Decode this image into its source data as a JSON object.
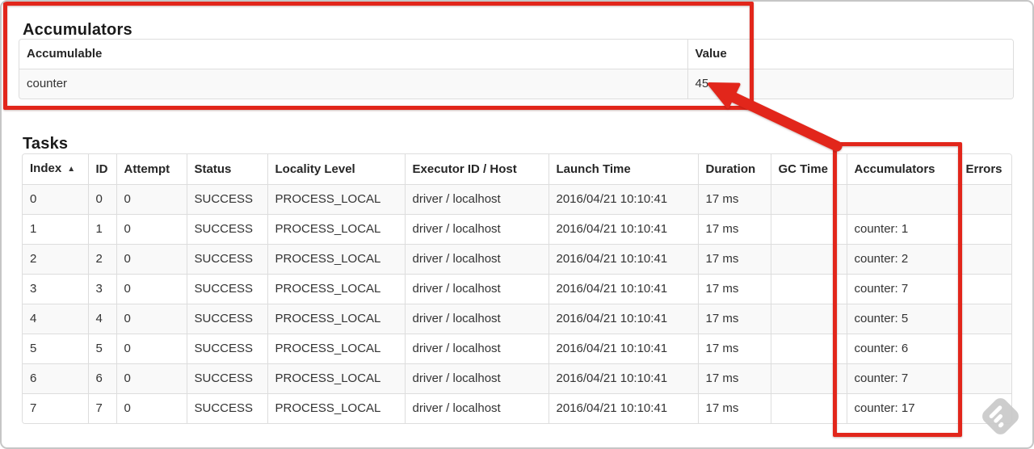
{
  "annotations": {
    "color": "#e2261b",
    "highlight_value": "45",
    "highlight_column": "Accumulators"
  },
  "accumulators_section": {
    "title": "Accumulators",
    "table": {
      "headers": {
        "accumulable": "Accumulable",
        "value": "Value"
      },
      "rows": [
        {
          "accumulable": "counter",
          "value": "45"
        }
      ]
    }
  },
  "tasks_section": {
    "title": "Tasks",
    "table": {
      "sort_icon": "▲",
      "headers": {
        "index": "Index",
        "id": "ID",
        "attempt": "Attempt",
        "status": "Status",
        "locality_level": "Locality Level",
        "executor_id_host": "Executor ID / Host",
        "launch_time": "Launch Time",
        "duration": "Duration",
        "gc_time": "GC Time",
        "accumulators": "Accumulators",
        "errors": "Errors"
      },
      "rows": [
        {
          "index": "0",
          "id": "0",
          "attempt": "0",
          "status": "SUCCESS",
          "locality_level": "PROCESS_LOCAL",
          "executor_id_host": "driver / localhost",
          "launch_time": "2016/04/21 10:10:41",
          "duration": "17 ms",
          "gc_time": "",
          "accumulators": "",
          "errors": ""
        },
        {
          "index": "1",
          "id": "1",
          "attempt": "0",
          "status": "SUCCESS",
          "locality_level": "PROCESS_LOCAL",
          "executor_id_host": "driver / localhost",
          "launch_time": "2016/04/21 10:10:41",
          "duration": "17 ms",
          "gc_time": "",
          "accumulators": "counter: 1",
          "errors": ""
        },
        {
          "index": "2",
          "id": "2",
          "attempt": "0",
          "status": "SUCCESS",
          "locality_level": "PROCESS_LOCAL",
          "executor_id_host": "driver / localhost",
          "launch_time": "2016/04/21 10:10:41",
          "duration": "17 ms",
          "gc_time": "",
          "accumulators": "counter: 2",
          "errors": ""
        },
        {
          "index": "3",
          "id": "3",
          "attempt": "0",
          "status": "SUCCESS",
          "locality_level": "PROCESS_LOCAL",
          "executor_id_host": "driver / localhost",
          "launch_time": "2016/04/21 10:10:41",
          "duration": "17 ms",
          "gc_time": "",
          "accumulators": "counter: 7",
          "errors": ""
        },
        {
          "index": "4",
          "id": "4",
          "attempt": "0",
          "status": "SUCCESS",
          "locality_level": "PROCESS_LOCAL",
          "executor_id_host": "driver / localhost",
          "launch_time": "2016/04/21 10:10:41",
          "duration": "17 ms",
          "gc_time": "",
          "accumulators": "counter: 5",
          "errors": ""
        },
        {
          "index": "5",
          "id": "5",
          "attempt": "0",
          "status": "SUCCESS",
          "locality_level": "PROCESS_LOCAL",
          "executor_id_host": "driver / localhost",
          "launch_time": "2016/04/21 10:10:41",
          "duration": "17 ms",
          "gc_time": "",
          "accumulators": "counter: 6",
          "errors": ""
        },
        {
          "index": "6",
          "id": "6",
          "attempt": "0",
          "status": "SUCCESS",
          "locality_level": "PROCESS_LOCAL",
          "executor_id_host": "driver / localhost",
          "launch_time": "2016/04/21 10:10:41",
          "duration": "17 ms",
          "gc_time": "",
          "accumulators": "counter: 7",
          "errors": ""
        },
        {
          "index": "7",
          "id": "7",
          "attempt": "0",
          "status": "SUCCESS",
          "locality_level": "PROCESS_LOCAL",
          "executor_id_host": "driver / localhost",
          "launch_time": "2016/04/21 10:10:41",
          "duration": "17 ms",
          "gc_time": "",
          "accumulators": "counter: 17",
          "errors": ""
        }
      ]
    }
  },
  "watermark": {
    "icon": "feedly-badge-icon"
  }
}
